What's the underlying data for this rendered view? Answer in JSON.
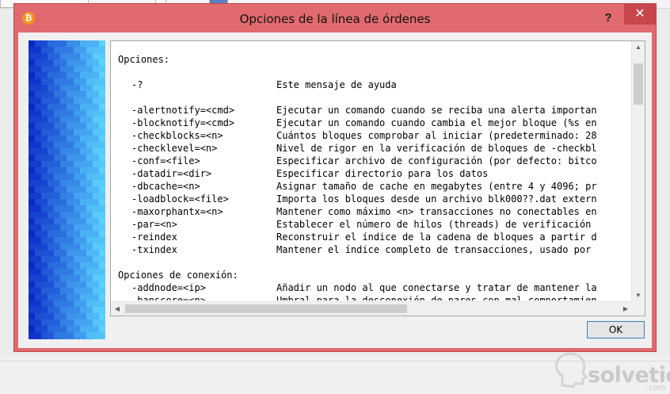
{
  "window": {
    "title": "Opciones de la línea de órdenes",
    "help_label": "?",
    "close_label": "✕",
    "app_icon": "bitcoin-icon",
    "accent": "#e06a6e"
  },
  "content": {
    "lines": [
      {
        "text": "Opciones:"
      },
      {
        "text": ""
      },
      {
        "opt": "-?",
        "desc": "Este mensaje de ayuda"
      },
      {
        "text": ""
      },
      {
        "opt": "-alertnotify=<cmd>",
        "desc": "Ejecutar un comando cuando se reciba una alerta importan"
      },
      {
        "opt": "-blocknotify=<cmd>",
        "desc": "Ejecutar un comando cuando cambia el mejor bloque (%s en"
      },
      {
        "opt": "-checkblocks=<n>",
        "desc": "Cuántos bloques comprobar al iniciar (predeterminado: 28"
      },
      {
        "opt": "-checklevel=<n>",
        "desc": "Nivel de rigor en la verificación de bloques de -checkbl"
      },
      {
        "opt": "-conf=<file>",
        "desc": "Especificar archivo de configuración (por defecto: bitco"
      },
      {
        "opt": "-datadir=<dir>",
        "desc": "Especificar directorio para los datos"
      },
      {
        "opt": "-dbcache=<n>",
        "desc": "Asignar tamaño de cache en megabytes (entre 4 y 4096; pr"
      },
      {
        "opt": "-loadblock=<file>",
        "desc": "Importa los bloques desde un archivo blk000??.dat extern"
      },
      {
        "opt": "-maxorphantx=<n>",
        "desc": "Mantener como máximo <n> transacciones no conectables en"
      },
      {
        "opt": "-par=<n>",
        "desc": "Establecer el número de hilos (threads) de verificación"
      },
      {
        "opt": "-reindex",
        "desc": "Reconstruir el índice de la cadena de bloques a partir d"
      },
      {
        "opt": "-txindex",
        "desc": "Mantener el índice completo de transacciones, usado por"
      },
      {
        "text": ""
      },
      {
        "text": "Opciones de conexión:"
      },
      {
        "opt": "-addnode=<ip>",
        "desc": "Añadir un nodo al que conectarse y tratar de mantener la"
      },
      {
        "opt": "-banscore=<n>",
        "desc": "Umbral para la desconexión de pares con mal comportamien"
      }
    ]
  },
  "buttons": {
    "ok_label": "OK"
  },
  "watermark": {
    "text": "solvetic",
    "domain": ".com"
  }
}
